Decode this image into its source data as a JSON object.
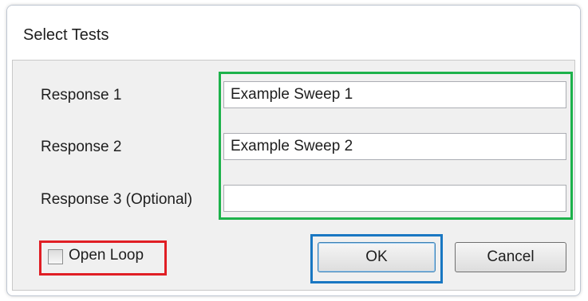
{
  "window": {
    "title": "Select Tests"
  },
  "form": {
    "responses": [
      {
        "label": "Response 1",
        "value": "Example Sweep 1"
      },
      {
        "label": "Response 2",
        "value": "Example Sweep 2"
      },
      {
        "label": "Response 3 (Optional)",
        "value": ""
      }
    ],
    "open_loop_label": "Open Loop",
    "open_loop_checked": false
  },
  "buttons": {
    "ok_label": "OK",
    "cancel_label": "Cancel"
  },
  "highlights": {
    "inputs_color": "#1db24b",
    "open_loop_color": "#e01e24",
    "ok_color": "#1977c2"
  }
}
